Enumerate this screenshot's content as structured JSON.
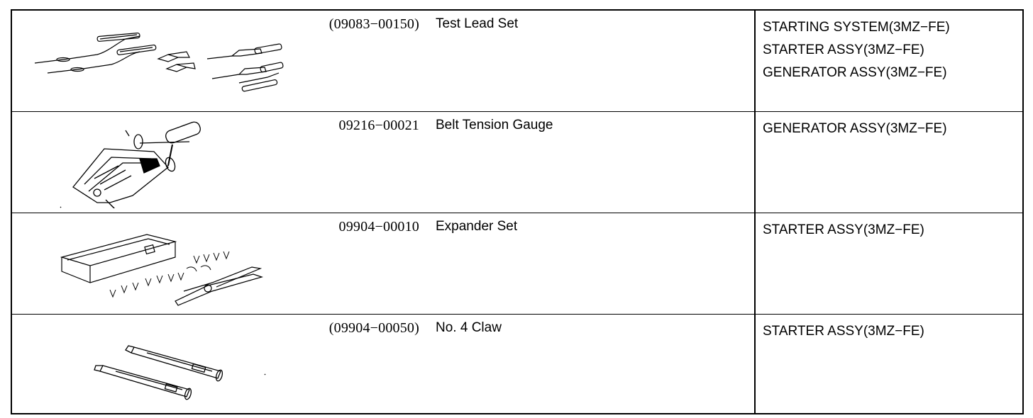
{
  "tools": [
    {
      "part_number": "(09083−00150)",
      "name": "Test Lead Set",
      "illustration": "test-lead-set-icon",
      "applications": [
        "STARTING SYSTEM(3MZ−FE)",
        "STARTER ASSY(3MZ−FE)",
        "GENERATOR ASSY(3MZ−FE)"
      ]
    },
    {
      "part_number": "09216−00021",
      "name": "Belt Tension Gauge",
      "illustration": "belt-tension-gauge-icon",
      "applications": [
        "GENERATOR ASSY(3MZ−FE)"
      ]
    },
    {
      "part_number": "09904−00010",
      "name": "Expander Set",
      "illustration": "expander-set-icon",
      "applications": [
        "STARTER ASSY(3MZ−FE)"
      ]
    },
    {
      "part_number": "(09904−00050)",
      "name": "No. 4 Claw",
      "illustration": "claw-icon",
      "applications": [
        "STARTER ASSY(3MZ−FE)"
      ]
    }
  ]
}
